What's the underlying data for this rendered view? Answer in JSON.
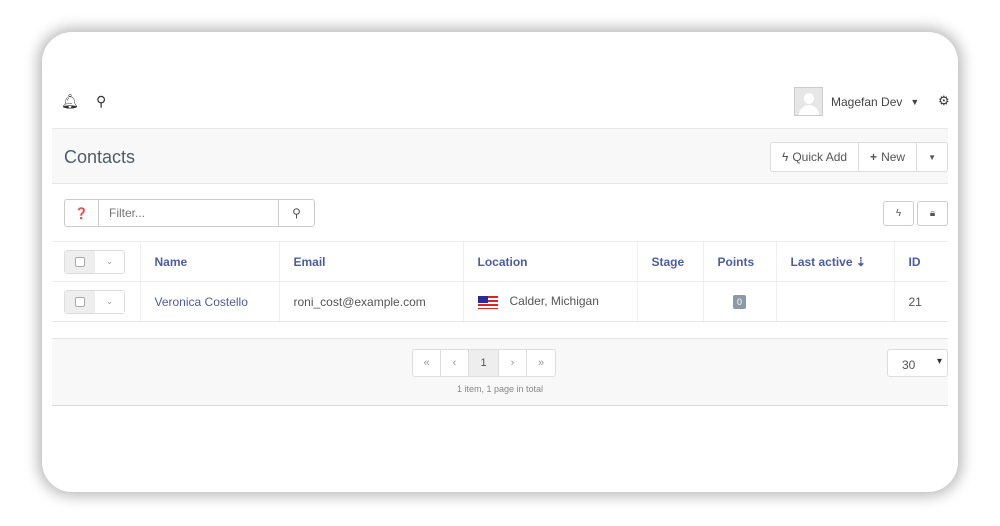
{
  "topbar": {
    "user_name": "Magefan Dev"
  },
  "page": {
    "title": "Contacts",
    "quick_add": "Quick Add",
    "new": "New"
  },
  "filter": {
    "placeholder": "Filter..."
  },
  "table": {
    "headers": [
      "Name",
      "Email",
      "Location",
      "Stage",
      "Points",
      "Last active",
      "ID"
    ],
    "rows": [
      {
        "name": "Veronica Costello",
        "email": "roni_cost@example.com",
        "location": "Calder, Michigan",
        "stage": "",
        "points": "0",
        "last_active": "",
        "id": "21"
      }
    ]
  },
  "pagination": {
    "first": "«",
    "prev": "‹",
    "current": "1",
    "next": "›",
    "last": "»",
    "info": "1 item, 1 page in total",
    "per_page": "30"
  }
}
